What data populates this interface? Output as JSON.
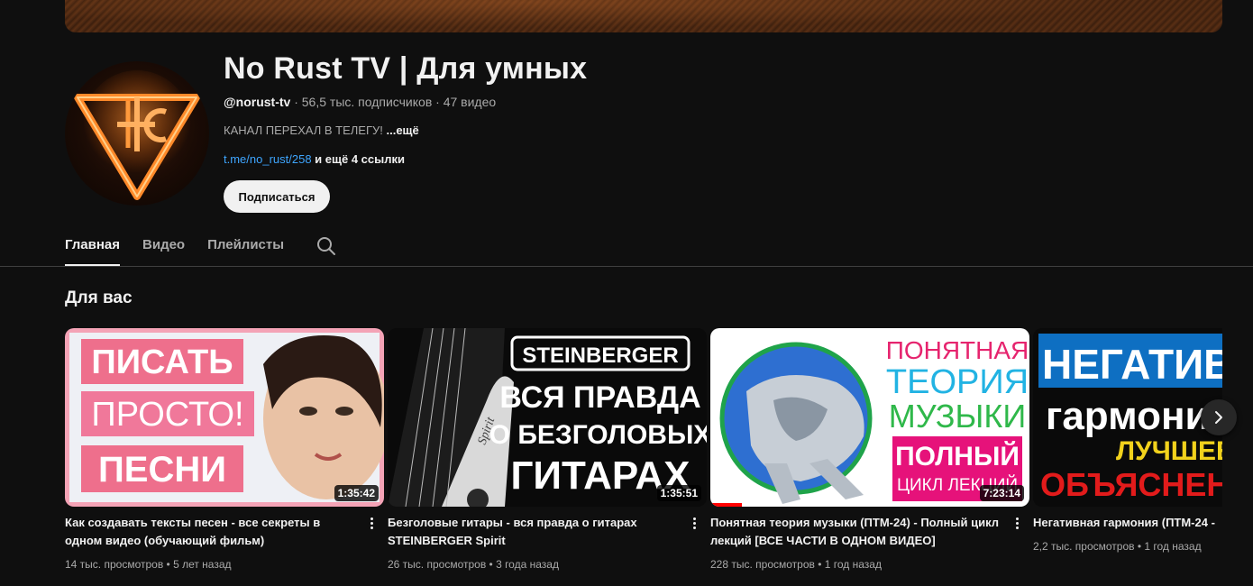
{
  "channel": {
    "name": "No Rust TV | Для умных",
    "handle": "@norust-tv",
    "stats": " · 56,5 тыс. подписчиков · 47 видео",
    "description": "КАНАЛ ПЕРЕХАЛ В ТЕЛЕГУ! ",
    "description_more": "...ещё",
    "link": "t.me/no_rust/258",
    "links_more": " и ещё 4 ссылки",
    "subscribe_label": "Подписаться"
  },
  "tabs": [
    {
      "label": "Главная",
      "active": true
    },
    {
      "label": "Видео",
      "active": false
    },
    {
      "label": "Плейлисты",
      "active": false
    }
  ],
  "section": {
    "title": "Для вас"
  },
  "videos": [
    {
      "title": "Как создавать тексты песен - все секреты в одном видео (обучающий фильм)",
      "meta": "14 тыс. просмотров • 5 лет назад",
      "duration": "1:35:42",
      "thumb_text": [
        "ПИСАТЬ",
        "ПРОСТО!",
        "ПЕСНИ"
      ]
    },
    {
      "title": "Безголовые гитары - вся правда о гитарах STEINBERGER Spirit",
      "meta": "26 тыс. просмотров • 3 года назад",
      "duration": "1:35:51",
      "thumb_text": [
        "STEINBERGER",
        "ВСЯ ПРАВДА",
        "О БЕЗГОЛОВЫХ",
        "ГИТАРАХ",
        "Spirit"
      ]
    },
    {
      "title": "Понятная теория музыки (ПТМ-24) - Полный цикл лекций [ВСЕ ЧАСТИ В ОДНОМ ВИДЕО]",
      "meta": "228 тыс. просмотров • 1 год назад",
      "duration": "7:23:14",
      "thumb_text": [
        "ПОНЯТНАЯ",
        "ТЕОРИЯ",
        "МУЗЫКИ",
        "ПОЛНЫЙ",
        "ЦИКЛ ЛЕКЦИЙ"
      ],
      "progress": 0.1
    },
    {
      "title": "Негативная гармония (ПТМ-24 -",
      "meta": "2,2 тыс. просмотров • 1 год назад",
      "thumb_text": [
        "НЕГАТИВН",
        "гармони",
        "ЛУЧШЕЕ",
        "ОБЪЯСНЕНИЕ"
      ]
    }
  ],
  "colors": {
    "accent_link": "#3ea6ff",
    "progress": "#ff0000"
  }
}
